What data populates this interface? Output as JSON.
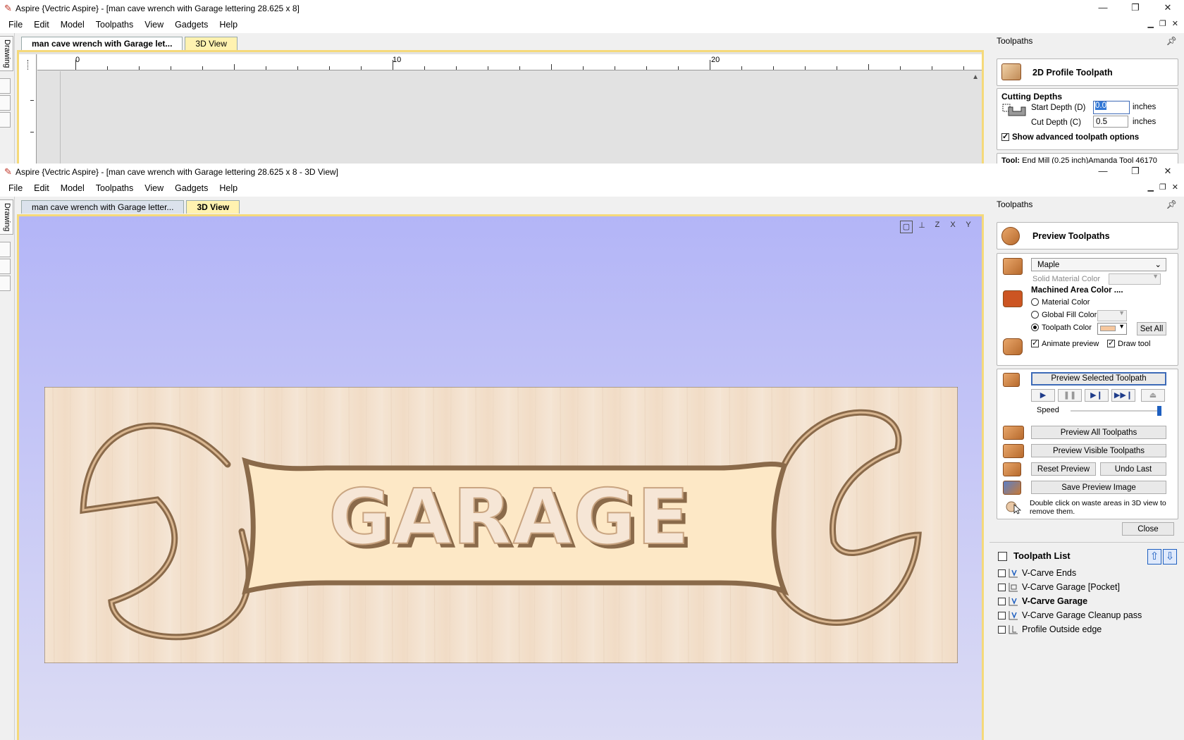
{
  "window1": {
    "title": "Aspire {Vectric Aspire} - [man cave wrench with Garage lettering 28.625 x 8]",
    "controls": {
      "minimize": "—",
      "maximize": "❐",
      "close": "✕"
    },
    "menu": [
      "File",
      "Edit",
      "Model",
      "Toolpaths",
      "View",
      "Gadgets",
      "Help"
    ],
    "tabs": [
      {
        "label": "man cave wrench with Garage let..."
      },
      {
        "label": "3D View"
      }
    ],
    "left_tab": "Drawing",
    "ruler": {
      "labels": [
        "0",
        "10",
        "20"
      ]
    },
    "panel": {
      "title": "Toolpaths",
      "header_label": "2D Profile Toolpath",
      "cutting_depths": {
        "heading": "Cutting Depths",
        "start_label": "Start Depth (D)",
        "start_value": "0.0",
        "cut_label": "Cut Depth (C)",
        "cut_value": "0.5",
        "unit": "inches"
      },
      "advanced_label": "Show advanced toolpath options",
      "tool_label": "Tool:",
      "tool_value": "End Mill (0.25 inch)Amanda Tool 46170"
    }
  },
  "window2": {
    "title": "Aspire {Vectric Aspire} - [man cave wrench with Garage lettering 28.625 x 8 - 3D View]",
    "controls": {
      "minimize": "—",
      "maximize": "❐",
      "close": "✕"
    },
    "menu": [
      "File",
      "Edit",
      "Model",
      "Toolpaths",
      "View",
      "Gadgets",
      "Help"
    ],
    "tabs": [
      {
        "label": "man cave wrench with Garage letter..."
      },
      {
        "label": "3D View"
      }
    ],
    "left_tab": "Drawing",
    "view3d": {
      "toolbar_icons": [
        "zoom-fit-icon",
        "iso-view-icon",
        "z-view-icon",
        "x-view-icon",
        "y-view-icon"
      ],
      "toolbar_text": [
        "Z",
        "X",
        "Y"
      ],
      "carving_text": "GARAGE"
    },
    "panel": {
      "title": "Toolpaths",
      "header_label": "Preview Toolpaths",
      "material": {
        "selected": "Maple",
        "solid_color_label": "Solid Material Color"
      },
      "machined": {
        "heading": "Machined Area Color ....",
        "material_color": "Material Color",
        "global_fill": "Global Fill Color",
        "toolpath_color": "Toolpath Color",
        "set_all": "Set All",
        "toolpath_color_swatch": "#f6c79e"
      },
      "animate_preview": "Animate preview",
      "draw_tool": "Draw tool",
      "preview_selected": "Preview Selected Toolpath",
      "speed_label": "Speed",
      "speed_value": 1.0,
      "preview_all": "Preview All Toolpaths",
      "preview_visible": "Preview Visible Toolpaths",
      "reset_preview": "Reset Preview",
      "undo_last": "Undo Last",
      "save_image": "Save Preview Image",
      "hint": "Double click on waste areas in 3D view to remove them.",
      "close": "Close"
    },
    "toolpath_list": {
      "heading": "Toolpath List",
      "items": [
        {
          "label": "V-Carve Ends",
          "bold": false,
          "checked": false
        },
        {
          "label": "V-Carve Garage [Pocket]",
          "bold": false,
          "checked": false
        },
        {
          "label": "V-Carve Garage",
          "bold": true,
          "checked": false
        },
        {
          "label": "V-Carve Garage Cleanup pass",
          "bold": false,
          "checked": false
        },
        {
          "label": "Profile Outside edge",
          "bold": false,
          "checked": false
        }
      ]
    }
  },
  "colors": {
    "view_bg_top": "#b3b5f7",
    "view_bg_bottom": "#dcdcf4",
    "wood": "#f4e2cf",
    "wood_pocket": "#fde8c6",
    "groove_dark": "#8a6a4a",
    "accent_blue": "#1e5fc0",
    "tab_yellow": "#fff2b0"
  }
}
